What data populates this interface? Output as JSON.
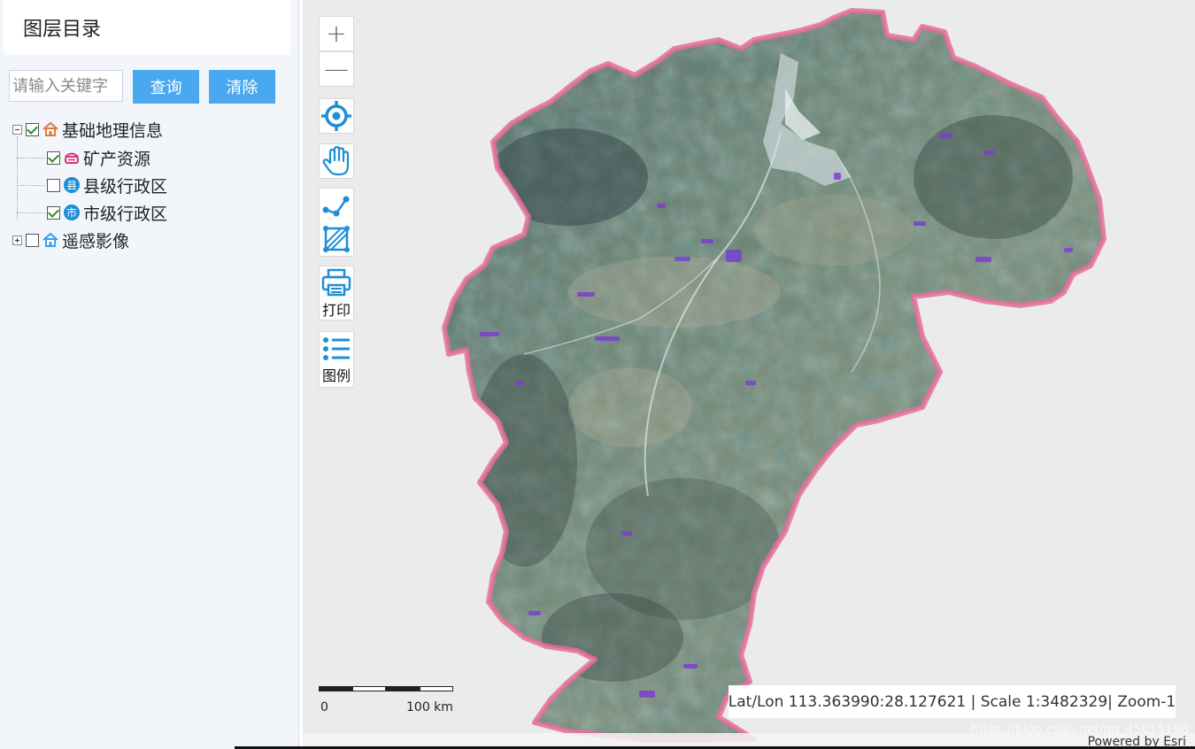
{
  "sidebar": {
    "title": "图层目录",
    "search": {
      "placeholder": "请输入关键字",
      "value": ""
    },
    "query_label": "查询",
    "clear_label": "清除",
    "tree": [
      {
        "label": "基础地理信息",
        "checked": true,
        "expanded": true,
        "icon": "home-icon",
        "children": [
          {
            "label": "矿产资源",
            "checked": true,
            "icon": "mineral-icon"
          },
          {
            "label": "县级行政区",
            "checked": false,
            "icon": "county-badge-icon",
            "badge": "县"
          },
          {
            "label": "市级行政区",
            "checked": true,
            "icon": "city-badge-icon",
            "badge": "市"
          }
        ]
      },
      {
        "label": "遥感影像",
        "checked": false,
        "expanded": false,
        "icon": "home-icon",
        "children": []
      }
    ]
  },
  "map": {
    "toolbar": {
      "zoom_in": "+",
      "zoom_out": "—",
      "print_label": "打印",
      "legend_label": "图例"
    },
    "scalebar": {
      "start_label": "0",
      "end_label": "100 km"
    },
    "coordinates": "Lat/Lon 113.363990:28.127621 | Scale 1:3482329| Zoom-1",
    "attribution": "Powered by Esri",
    "watermark": "https://blog.csdn.net/qq_45015198",
    "colors": {
      "background": "#ebebeb",
      "boundary": "#e56f9a",
      "imagery": "#5f7a6d",
      "accent": "#4aa8f0",
      "icon_blue": "#1d8fd6",
      "mineral_purple": "#7b3fd1"
    }
  }
}
